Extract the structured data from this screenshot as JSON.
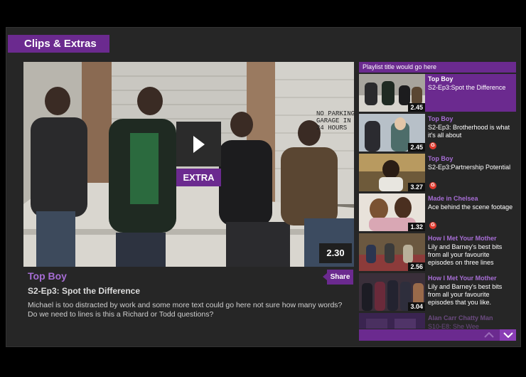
{
  "header": {
    "title": "Clips & Extras"
  },
  "player": {
    "badge": "EXTRA",
    "duration": "2.30",
    "show_title": "Top Boy",
    "episode_title": "S2-Ep3: Spot the Difference",
    "description": "Michael is too distracted by work and some more text could go here not sure how many words? Do we need to lines is this a Richard or Todd questions?",
    "share_label": "Share",
    "sign_text": "NO PARKING\nGARAGE IN USE\n24 HOURS"
  },
  "playlist": {
    "title": "Playlist title would go here",
    "items": [
      {
        "show": "Top Boy",
        "desc": "S2-Ep3:Spot the Difference",
        "duration": "2.45",
        "guidance": ""
      },
      {
        "show": "Top Boy",
        "desc": "S2-Ep3: Brotherhood is what it's all about",
        "duration": "2.45",
        "guidance": "G"
      },
      {
        "show": "Top Boy",
        "desc": "S2-Ep3:Partnership Potential",
        "duration": "3.27",
        "guidance": "G"
      },
      {
        "show": "Made in Chelsea",
        "desc": "Ace behind the scene footage",
        "duration": "1.32",
        "guidance": "G"
      },
      {
        "show": "How I Met Your Mother",
        "desc": "Lily and Barney's best bits from all your favourite episodes on three lines",
        "duration": "2.56",
        "guidance": ""
      },
      {
        "show": "How I Met Your Mother",
        "desc": "Lily and Barney's best bits from all your favourite episodes that you like.",
        "duration": "3.04",
        "guidance": ""
      },
      {
        "show": "Alan Carr Chatty Man",
        "desc": "S10-E8: She Wee",
        "duration": "",
        "guidance": ""
      }
    ]
  },
  "colors": {
    "accent": "#6b2a8f",
    "accent_text": "#a66dd4",
    "panel": "#262626",
    "guidance": "#e03b2f"
  },
  "icons": {
    "play": "play-icon",
    "up": "chevron-up-icon",
    "down": "chevron-down-icon"
  }
}
